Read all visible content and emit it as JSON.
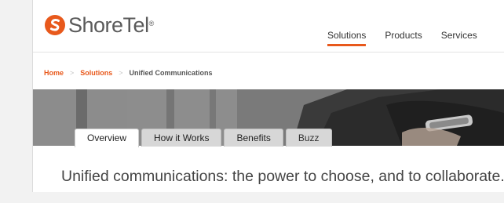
{
  "brand": {
    "name": "ShoreTel",
    "registered": "®",
    "accent_color": "#e8591c"
  },
  "topnav": {
    "items": [
      {
        "label": "Solutions",
        "active": true
      },
      {
        "label": "Products",
        "active": false
      },
      {
        "label": "Services",
        "active": false
      }
    ]
  },
  "breadcrumb": {
    "home": "Home",
    "solutions": "Solutions",
    "current": "Unified Communications",
    "separator": ">"
  },
  "tabs": [
    {
      "label": "Overview",
      "active": true
    },
    {
      "label": "How it Works",
      "active": false
    },
    {
      "label": "Benefits",
      "active": false
    },
    {
      "label": "Buzz",
      "active": false
    }
  ],
  "main": {
    "headline": "Unified communications: the power to choose, and to collaborate."
  }
}
